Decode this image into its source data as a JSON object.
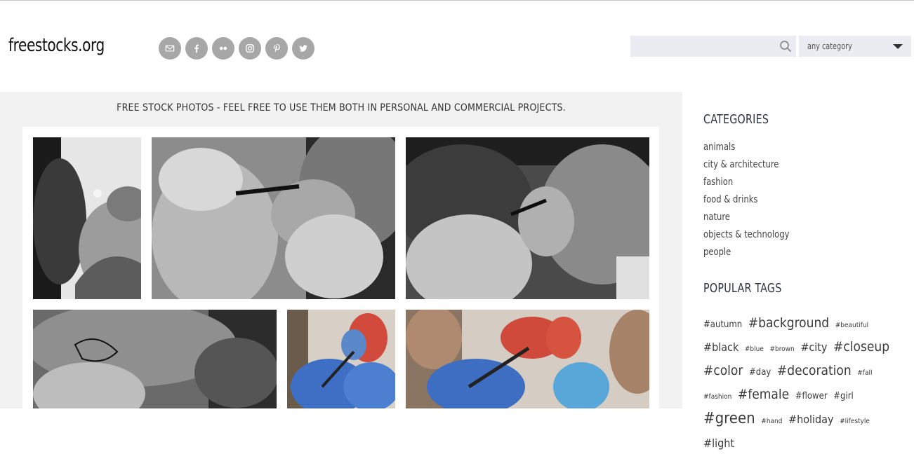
{
  "site": {
    "logo": "freestocks.org"
  },
  "social": [
    {
      "name": "email-icon"
    },
    {
      "name": "facebook-icon"
    },
    {
      "name": "flickr-icon"
    },
    {
      "name": "instagram-icon"
    },
    {
      "name": "pinterest-icon"
    },
    {
      "name": "twitter-icon"
    }
  ],
  "search": {
    "placeholder": "",
    "value": ""
  },
  "category_select": {
    "selected": "any category"
  },
  "main": {
    "tagline": "FREE STOCK PHOTOS - FEEL FREE TO USE THEM BOTH IN PERSONAL AND COMMERCIAL PROJECTS."
  },
  "sidebar": {
    "categories_title": "CATEGORIES",
    "categories": [
      "animals",
      "city & architecture",
      "fashion",
      "food & drinks",
      "nature",
      "objects & technology",
      "people"
    ],
    "tags_title": "POPULAR TAGS",
    "tags": [
      {
        "label": "#autumn",
        "size": "s"
      },
      {
        "label": "#background",
        "size": "l"
      },
      {
        "label": "#beautiful",
        "size": "xs"
      },
      {
        "label": "#black",
        "size": "m"
      },
      {
        "label": "#blue",
        "size": "xs"
      },
      {
        "label": "#brown",
        "size": "xs"
      },
      {
        "label": "#city",
        "size": "m"
      },
      {
        "label": "#closeup",
        "size": "l"
      },
      {
        "label": "#color",
        "size": "l"
      },
      {
        "label": "#day",
        "size": "s"
      },
      {
        "label": "#decoration",
        "size": "l"
      },
      {
        "label": "#fall",
        "size": "xs"
      },
      {
        "label": "#fashion",
        "size": "xs"
      },
      {
        "label": "#female",
        "size": "l"
      },
      {
        "label": "#flower",
        "size": "s"
      },
      {
        "label": "#girl",
        "size": "s"
      },
      {
        "label": "#green",
        "size": "xl"
      },
      {
        "label": "#hand",
        "size": "xs"
      },
      {
        "label": "#holiday",
        "size": "m"
      },
      {
        "label": "#lifestyle",
        "size": "xs"
      },
      {
        "label": "#light",
        "size": "m"
      }
    ]
  },
  "colors": {
    "main_bg": "#f3f2f2",
    "social_bg": "#a7a7a7",
    "input_bg": "#e9ecf1",
    "heading": "#2b3440"
  }
}
